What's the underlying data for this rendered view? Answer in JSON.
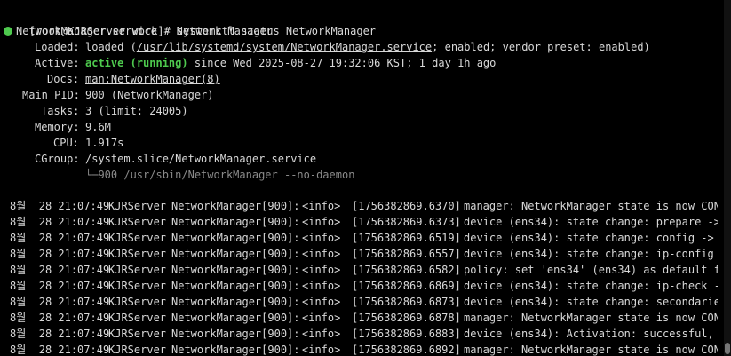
{
  "prompt": "[root@KJRServer work]# systemctl status NetworkManager",
  "service_header": "NetworkManager.service - Network Manager",
  "status": {
    "loaded_label": "Loaded:",
    "loaded_prefix": "loaded (",
    "loaded_path": "/usr/lib/systemd/system/NetworkManager.service",
    "loaded_suffix": "; enabled; vendor preset: enabled)",
    "active_label": "Active:",
    "active_state": "active (running)",
    "active_since": " since Wed 2025-08-27 19:32:06 KST; 1 day 1h ago",
    "docs_label": "Docs:",
    "docs_value": "man:NetworkManager(8)",
    "pid_label": "Main PID:",
    "pid_value": "900 (NetworkManager)",
    "tasks_label": "Tasks:",
    "tasks_value": "3 (limit: 24005)",
    "memory_label": "Memory:",
    "memory_value": "9.6M",
    "cpu_label": "CPU:",
    "cpu_value": "1.917s",
    "cgroup_label": "CGroup:",
    "cgroup_value": "/system.slice/NetworkManager.service",
    "cgroup_child": "└─900 /usr/sbin/NetworkManager --no-daemon"
  },
  "logs": [
    {
      "date": "8월  28 21:07:49",
      "host": "KJRServer",
      "proc": "NetworkManager[900]:",
      "level": "<info>",
      "ts": "[1756382869.6370]",
      "msg": "manager: NetworkManager state is now CON"
    },
    {
      "date": "8월  28 21:07:49",
      "host": "KJRServer",
      "proc": "NetworkManager[900]:",
      "level": "<info>",
      "ts": "[1756382869.6373]",
      "msg": "device (ens34): state change: prepare ->"
    },
    {
      "date": "8월  28 21:07:49",
      "host": "KJRServer",
      "proc": "NetworkManager[900]:",
      "level": "<info>",
      "ts": "[1756382869.6519]",
      "msg": "device (ens34): state change: config -> "
    },
    {
      "date": "8월  28 21:07:49",
      "host": "KJRServer",
      "proc": "NetworkManager[900]:",
      "level": "<info>",
      "ts": "[1756382869.6557]",
      "msg": "device (ens34): state change: ip-config "
    },
    {
      "date": "8월  28 21:07:49",
      "host": "KJRServer",
      "proc": "NetworkManager[900]:",
      "level": "<info>",
      "ts": "[1756382869.6582]",
      "msg": "policy: set 'ens34' (ens34) as default f"
    },
    {
      "date": "8월  28 21:07:49",
      "host": "KJRServer",
      "proc": "NetworkManager[900]:",
      "level": "<info>",
      "ts": "[1756382869.6869]",
      "msg": "device (ens34): state change: ip-check -"
    },
    {
      "date": "8월  28 21:07:49",
      "host": "KJRServer",
      "proc": "NetworkManager[900]:",
      "level": "<info>",
      "ts": "[1756382869.6873]",
      "msg": "device (ens34): state change: secondarie"
    },
    {
      "date": "8월  28 21:07:49",
      "host": "KJRServer",
      "proc": "NetworkManager[900]:",
      "level": "<info>",
      "ts": "[1756382869.6878]",
      "msg": "manager: NetworkManager state is now CON"
    },
    {
      "date": "8월  28 21:07:49",
      "host": "KJRServer",
      "proc": "NetworkManager[900]:",
      "level": "<info>",
      "ts": "[1756382869.6883]",
      "msg": "device (ens34): Activation: successful, "
    },
    {
      "date": "8월  28 21:07:49",
      "host": "KJRServer",
      "proc": "NetworkManager[900]:",
      "level": "<info>",
      "ts": "[1756382869.6892]",
      "msg": "manager: NetworkManager state is now CON"
    }
  ],
  "colors": {
    "background": "#000000",
    "foreground": "#d8d8d8",
    "active_green": "#4ec94e",
    "dim": "#8a8a8a"
  },
  "icons": {
    "status_dot": "status-dot-icon"
  }
}
